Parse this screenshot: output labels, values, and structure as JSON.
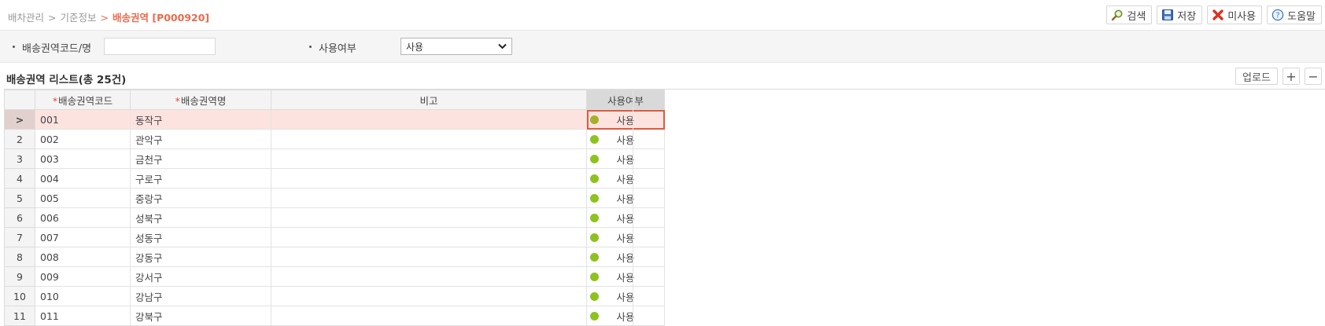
{
  "breadcrumb": {
    "items": [
      "배차관리",
      "기준정보"
    ],
    "separator": ">",
    "current": "배송권역 [P000920]"
  },
  "toolbar": {
    "search": "검색",
    "save": "저장",
    "disable": "미사용",
    "help": "도움말"
  },
  "search": {
    "code_label": "배송권역코드/명",
    "code_value": "",
    "use_label": "사용여부",
    "use_value": "사용"
  },
  "list": {
    "title": "배송권역 리스트(총 25건)",
    "upload": "업로드",
    "add": "+",
    "remove": "−"
  },
  "grid": {
    "columns": {
      "code": "배송권역코드",
      "name": "배송권역명",
      "note": "비고",
      "use": "사용여부"
    },
    "required_mark": "*",
    "selected_marker": ">",
    "rows": [
      {
        "no": ">",
        "code": "001",
        "name": "동작구",
        "note": "",
        "use": "사용"
      },
      {
        "no": "2",
        "code": "002",
        "name": "관악구",
        "note": "",
        "use": "사용"
      },
      {
        "no": "3",
        "code": "003",
        "name": "금천구",
        "note": "",
        "use": "사용"
      },
      {
        "no": "4",
        "code": "004",
        "name": "구로구",
        "note": "",
        "use": "사용"
      },
      {
        "no": "5",
        "code": "005",
        "name": "중랑구",
        "note": "",
        "use": "사용"
      },
      {
        "no": "6",
        "code": "006",
        "name": "성북구",
        "note": "",
        "use": "사용"
      },
      {
        "no": "7",
        "code": "007",
        "name": "성동구",
        "note": "",
        "use": "사용"
      },
      {
        "no": "8",
        "code": "008",
        "name": "강동구",
        "note": "",
        "use": "사용"
      },
      {
        "no": "9",
        "code": "009",
        "name": "강서구",
        "note": "",
        "use": "사용"
      },
      {
        "no": "10",
        "code": "010",
        "name": "강남구",
        "note": "",
        "use": "사용"
      },
      {
        "no": "11",
        "code": "011",
        "name": "강북구",
        "note": "",
        "use": "사용"
      }
    ]
  },
  "colors": {
    "accent": "#e96b4f",
    "status_green": "#8dc21f",
    "selected_row": "#fde3df"
  }
}
